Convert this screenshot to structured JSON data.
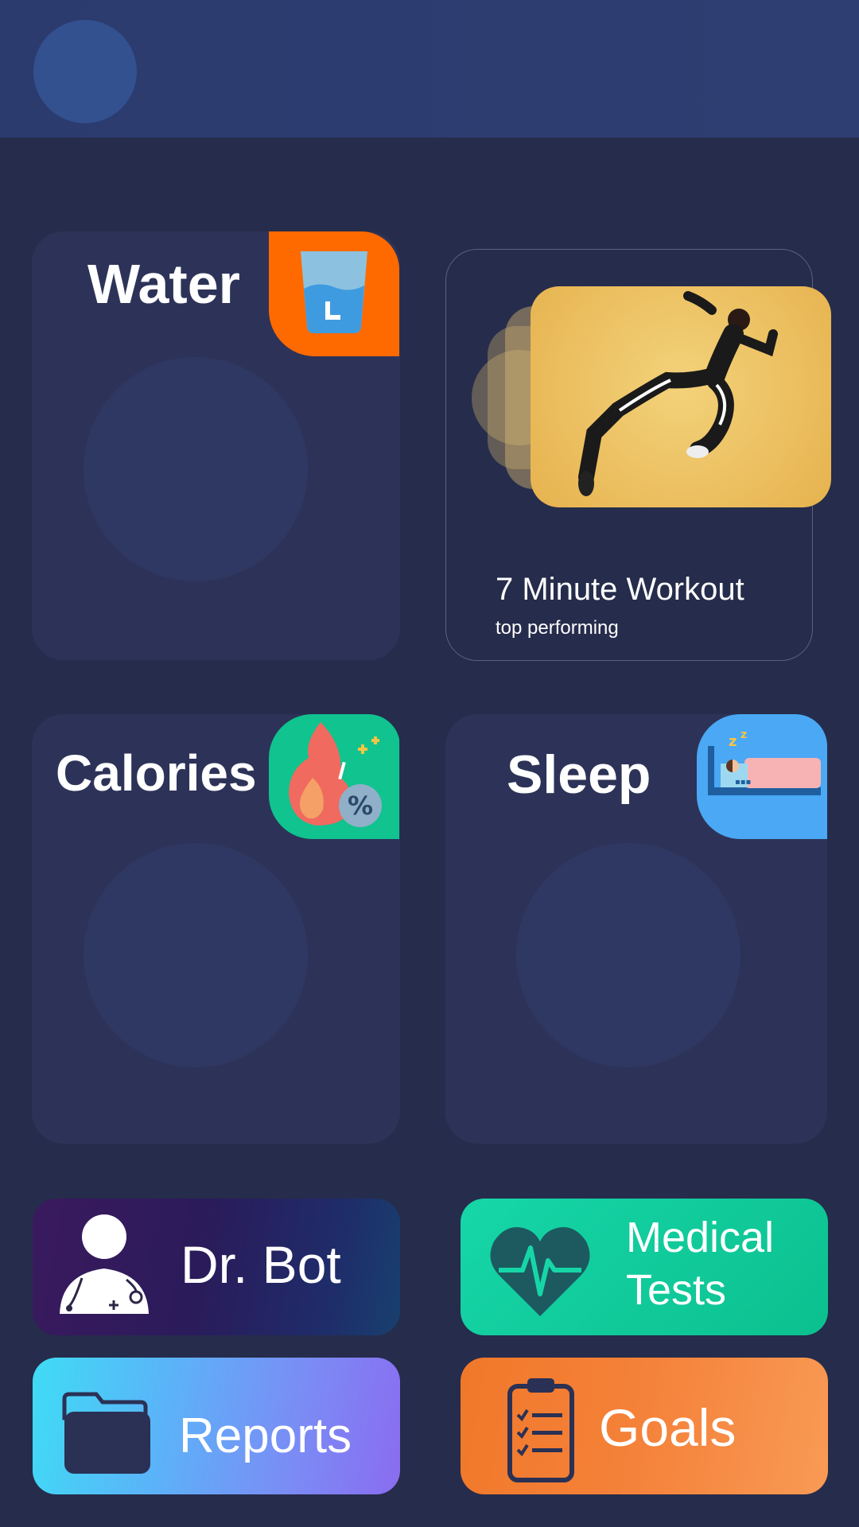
{
  "cards": {
    "water": {
      "title": "Water",
      "icon": "water-glass-icon",
      "badge_color": "#ff6a00"
    },
    "calories": {
      "title": "Calories",
      "icon": "fire-calories-icon",
      "badge_color": "#10c38f"
    },
    "sleep": {
      "title": "Sleep",
      "icon": "bed-sleep-icon",
      "badge_color": "#4aa8f5"
    }
  },
  "workout": {
    "title": "7 Minute Workout",
    "subtitle": "top performing",
    "image": "running-woman-photo"
  },
  "tiles": {
    "dr_bot": {
      "label": "Dr. Bot",
      "icon": "doctor-icon"
    },
    "medical_tests": {
      "label_line1": "Medical",
      "label_line2": "Tests",
      "icon": "heartbeat-icon"
    },
    "reports": {
      "label": "Reports",
      "icon": "folder-icon"
    },
    "goals": {
      "label": "Goals",
      "icon": "clipboard-checklist-icon"
    }
  }
}
